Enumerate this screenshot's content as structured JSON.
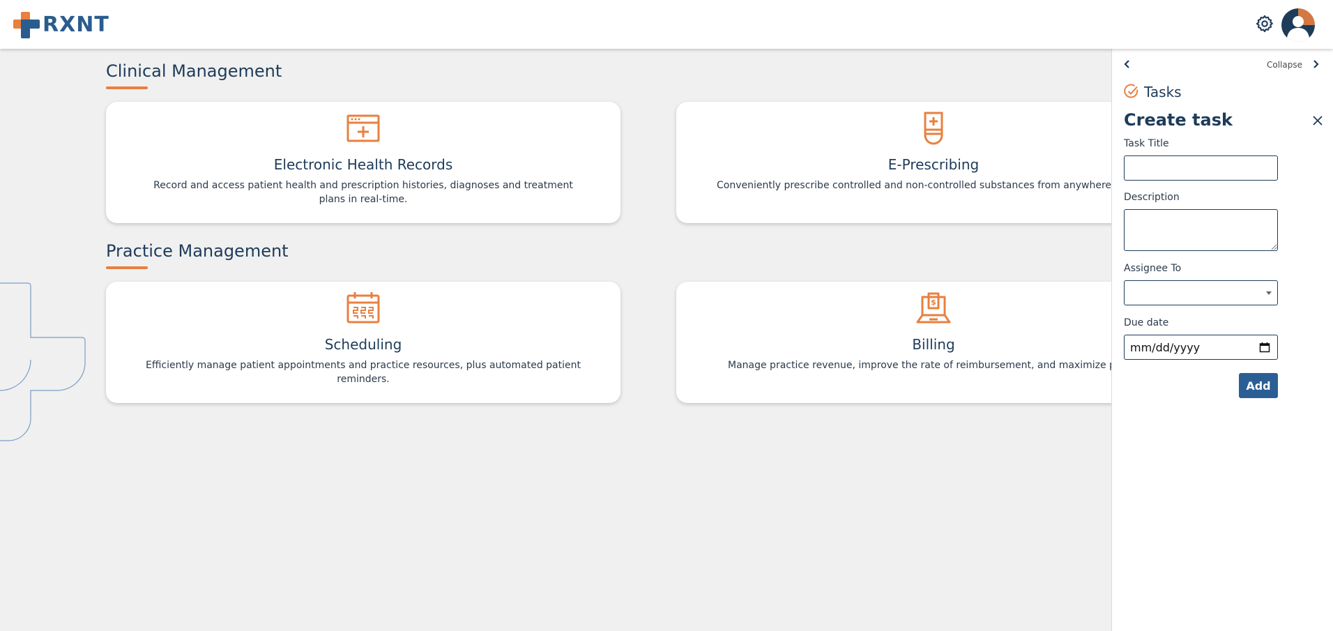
{
  "header": {
    "logo_text": "RXNT",
    "settings_icon": "gear-icon",
    "avatar_icon": "user-avatar-icon"
  },
  "colors": {
    "accent": "#e8803f",
    "brand_blue": "#2a5c8e",
    "heading": "#1e3b5a",
    "button": "#2b5e94"
  },
  "sections": [
    {
      "title": "Clinical Management",
      "cards": [
        {
          "icon": "health-records-icon",
          "title": "Electronic Health Records",
          "description": "Record and access patient health and prescription histories, diagnoses and treatment plans in real-time."
        },
        {
          "icon": "prescription-bottle-icon",
          "title": "E-Prescribing",
          "description": "Conveniently prescribe controlled and non-controlled substances from anywhere, at a"
        }
      ]
    },
    {
      "title": "Practice Management",
      "cards": [
        {
          "icon": "calendar-icon",
          "title": "Scheduling",
          "description": "Efficiently manage patient appointments and practice resources, plus automated patient reminders."
        },
        {
          "icon": "billing-laptop-icon",
          "title": "Billing",
          "description": "Manage practice revenue, improve the rate of reimbursement, and maximize profita"
        }
      ]
    }
  ],
  "panel": {
    "collapse_label": "Collapse",
    "tasks_label": "Tasks",
    "create_title": "Create task",
    "task_title_label": "Task Title",
    "task_title_value": "",
    "description_label": "Description",
    "description_value": "",
    "assignee_label": "Assignee To",
    "assignee_value": "",
    "due_date_label": "Due date",
    "due_date_placeholder": "mm/dd/yyyy",
    "add_label": "Add"
  }
}
